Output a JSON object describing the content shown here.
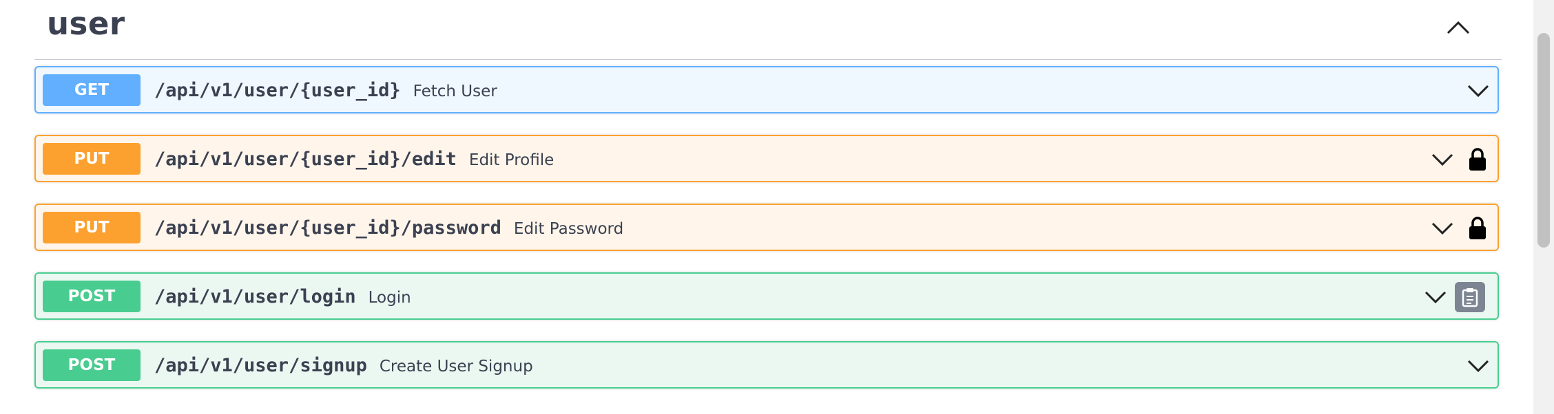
{
  "section": {
    "title": "user"
  },
  "operations": [
    {
      "method": "GET",
      "path": "/api/v1/user/{user_id}",
      "summary": "Fetch User",
      "locked": false,
      "clipboard": false
    },
    {
      "method": "PUT",
      "path": "/api/v1/user/{user_id}/edit",
      "summary": "Edit Profile",
      "locked": true,
      "clipboard": false
    },
    {
      "method": "PUT",
      "path": "/api/v1/user/{user_id}/password",
      "summary": "Edit Password",
      "locked": true,
      "clipboard": false
    },
    {
      "method": "POST",
      "path": "/api/v1/user/login",
      "summary": "Login",
      "locked": false,
      "clipboard": true
    },
    {
      "method": "POST",
      "path": "/api/v1/user/signup",
      "summary": "Create User Signup",
      "locked": false,
      "clipboard": false
    }
  ],
  "icons": {
    "collapse": "chevron-up-icon",
    "expand": "chevron-down-icon",
    "lock": "lock-icon",
    "clipboard": "clipboard-icon"
  },
  "colors": {
    "get": "#61affe",
    "put": "#fca130",
    "post": "#49cc90",
    "text": "#3b4151"
  }
}
